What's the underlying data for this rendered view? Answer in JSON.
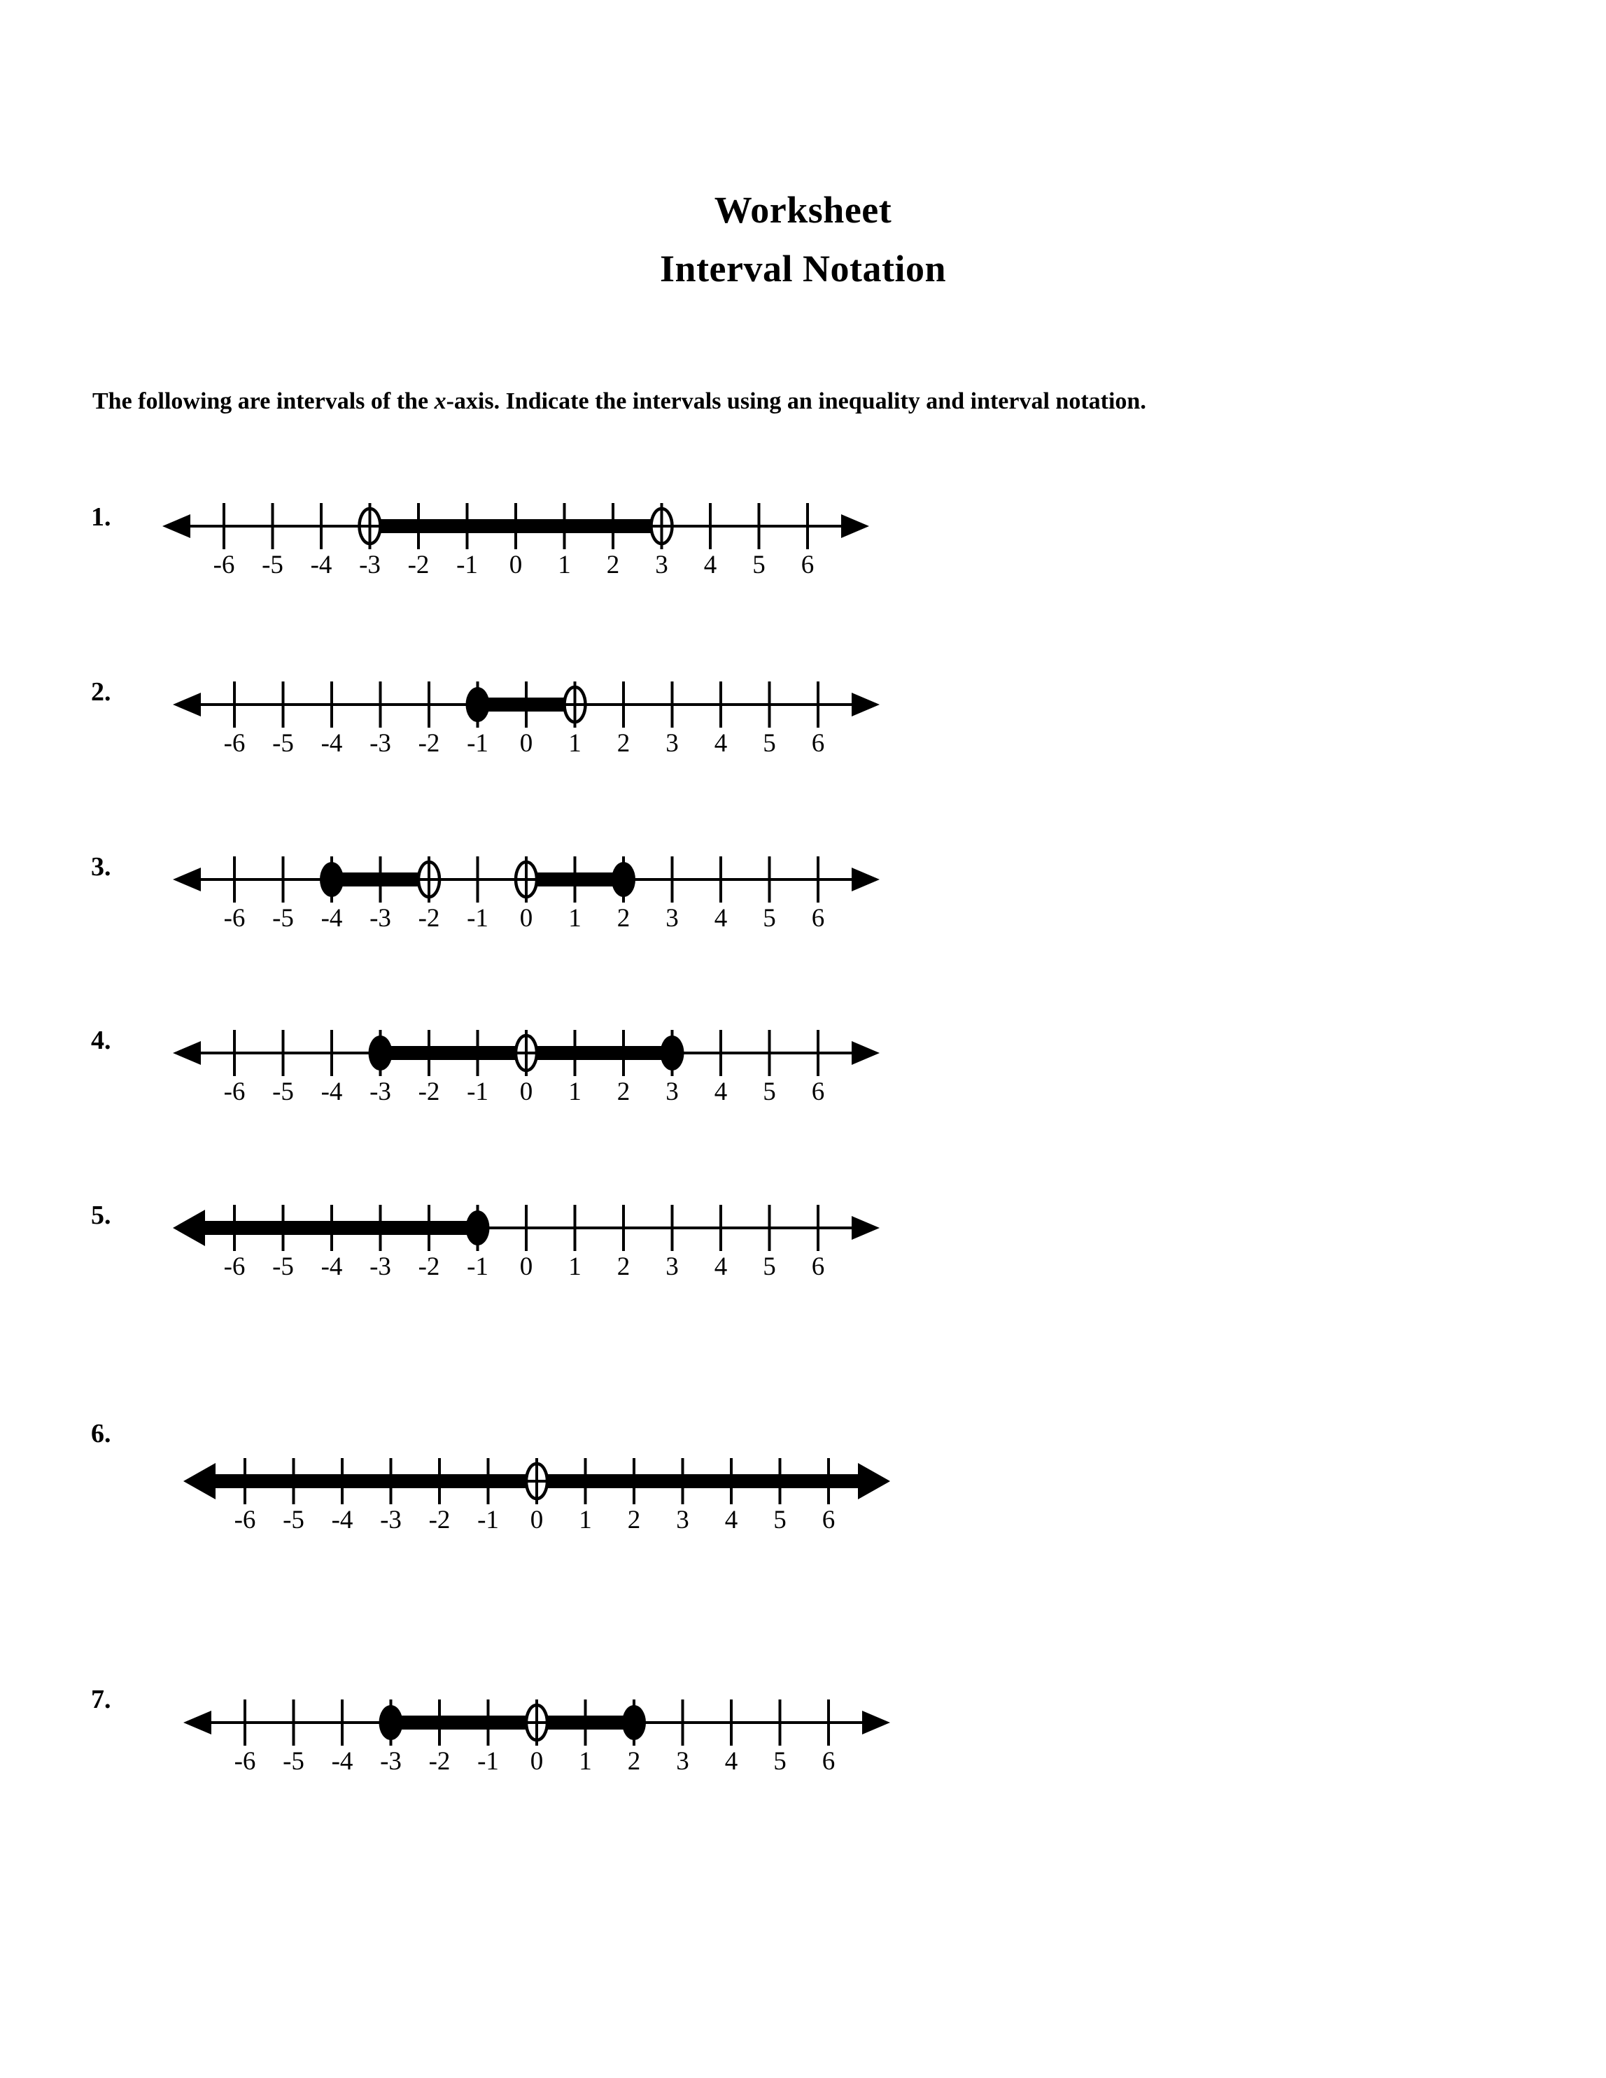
{
  "title": {
    "line1": "Worksheet",
    "line2": "Interval Notation"
  },
  "instruction": {
    "part1": "The following are intervals of the ",
    "variable": "x",
    "part2": "-axis.  Indicate the intervals using an inequality and interval notation."
  },
  "axis": {
    "tick_labels": [
      "-6",
      "-5",
      "-4",
      "-3",
      "-2",
      "-1",
      "0",
      "1",
      "2",
      "3",
      "4",
      "5",
      "6"
    ],
    "min": -6,
    "max": 6,
    "colors": {
      "ink": "#000000",
      "paper": "#ffffff"
    }
  },
  "problems": [
    {
      "number": "1.",
      "left_arrow": "thin",
      "right_arrow": "thin",
      "segments": [
        {
          "from": -3,
          "to": 3
        }
      ],
      "endpoints": [
        {
          "at": -3,
          "type": "open"
        },
        {
          "at": 3,
          "type": "open"
        }
      ]
    },
    {
      "number": "2.",
      "left_arrow": "thin",
      "right_arrow": "thin",
      "segments": [
        {
          "from": -1,
          "to": 1
        }
      ],
      "endpoints": [
        {
          "at": -1,
          "type": "closed"
        },
        {
          "at": 1,
          "type": "open"
        }
      ]
    },
    {
      "number": "3.",
      "left_arrow": "thin",
      "right_arrow": "thin",
      "segments": [
        {
          "from": -4,
          "to": -2
        },
        {
          "from": 0,
          "to": 2
        }
      ],
      "endpoints": [
        {
          "at": -4,
          "type": "closed"
        },
        {
          "at": -2,
          "type": "open"
        },
        {
          "at": 0,
          "type": "open"
        },
        {
          "at": 2,
          "type": "closed"
        }
      ]
    },
    {
      "number": "4.",
      "left_arrow": "thin",
      "right_arrow": "thin",
      "segments": [
        {
          "from": -3,
          "to": 3
        }
      ],
      "endpoints": [
        {
          "at": -3,
          "type": "closed"
        },
        {
          "at": 0,
          "type": "open"
        },
        {
          "at": 3,
          "type": "closed"
        }
      ]
    },
    {
      "number": "5.",
      "left_arrow": "thick",
      "right_arrow": "thin",
      "segments": [
        {
          "from": -7.2,
          "to": -1
        }
      ],
      "endpoints": [
        {
          "at": -1,
          "type": "closed"
        }
      ]
    },
    {
      "number": "6.",
      "left_arrow": "thick",
      "right_arrow": "thick",
      "segments": [
        {
          "from": -7.2,
          "to": 7.2
        }
      ],
      "endpoints": [
        {
          "at": 0,
          "type": "open"
        }
      ]
    },
    {
      "number": "7.",
      "left_arrow": "thin",
      "right_arrow": "thin",
      "segments": [
        {
          "from": -3,
          "to": 2
        }
      ],
      "endpoints": [
        {
          "at": -3,
          "type": "closed"
        },
        {
          "at": 0,
          "type": "open"
        },
        {
          "at": 2,
          "type": "closed"
        }
      ]
    }
  ],
  "layout": {
    "problem_tops": [
      690,
      945,
      1195,
      1443,
      1693,
      2030,
      2385
    ],
    "num_lefts": [
      130,
      130,
      130,
      130,
      130,
      130,
      130
    ],
    "num_offsets_y": [
      30,
      25,
      25,
      25,
      25,
      0,
      25
    ],
    "line_lefts": [
      200,
      215,
      215,
      215,
      215,
      230,
      230
    ],
    "line_tops": [
      690,
      945,
      1195,
      1443,
      1693,
      2055,
      2400
    ]
  }
}
